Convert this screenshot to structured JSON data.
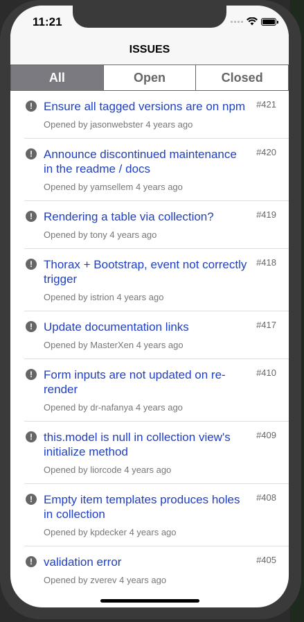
{
  "status_bar": {
    "time": "11:21"
  },
  "nav": {
    "title": "ISSUES"
  },
  "filter": {
    "segments": [
      {
        "label": "All",
        "active": true
      },
      {
        "label": "Open",
        "active": false
      },
      {
        "label": "Closed",
        "active": false
      }
    ]
  },
  "issues": [
    {
      "title": "Ensure all tagged versions are on npm",
      "number": "#421",
      "meta": "Opened by jasonwebster 4 years ago"
    },
    {
      "title": "Announce discontinued maintenance in the readme / docs",
      "number": "#420",
      "meta": "Opened by yamsellem 4 years ago"
    },
    {
      "title": "Rendering a table via collection?",
      "number": "#419",
      "meta": "Opened by tony 4 years ago"
    },
    {
      "title": "Thorax + Bootstrap, event not correctly trigger",
      "number": "#418",
      "meta": "Opened by istrion 4 years ago"
    },
    {
      "title": "Update documentation links",
      "number": "#417",
      "meta": "Opened by MasterXen 4 years ago"
    },
    {
      "title": "Form inputs are not updated on re-render",
      "number": "#410",
      "meta": "Opened by dr-nafanya 4 years ago"
    },
    {
      "title": "this.model is null in collection view's initialize method",
      "number": "#409",
      "meta": "Opened by liorcode 4 years ago"
    },
    {
      "title": "Empty item templates produces holes in collection",
      "number": "#408",
      "meta": "Opened by kpdecker 4 years ago"
    },
    {
      "title": "validation error",
      "number": "#405",
      "meta": "Opened by zverev 4 years ago"
    }
  ],
  "icons": {
    "issue": "alert-circle-icon",
    "wifi": "wifi-icon",
    "battery": "battery-icon",
    "signal": "signal-icon"
  },
  "colors": {
    "link": "#1f3fbf",
    "segment_active": "#7a7a80"
  }
}
